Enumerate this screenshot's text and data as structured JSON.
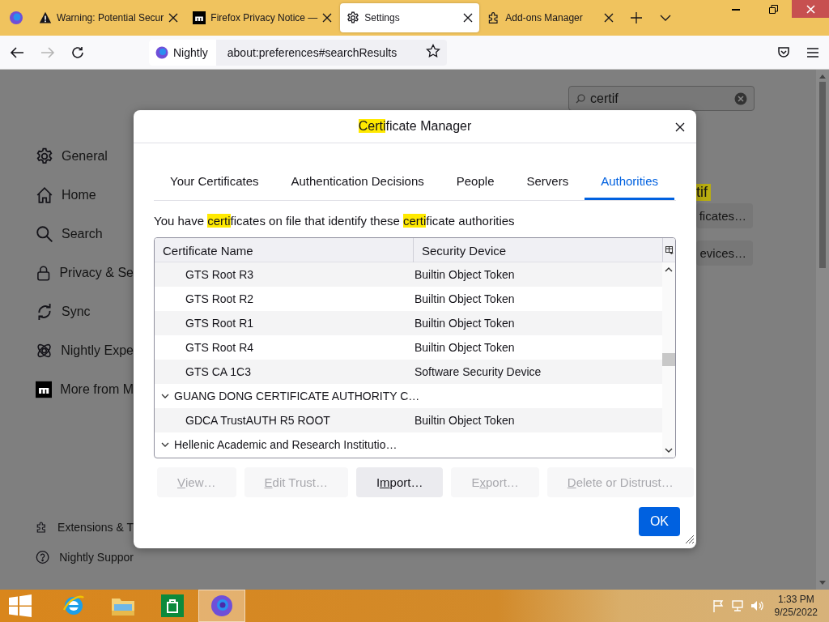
{
  "browser": {
    "tabs": [
      {
        "title": "Warning: Potential Secur",
        "kind": "warning",
        "selected": false
      },
      {
        "title": "Firefox Privacy Notice —",
        "kind": "square",
        "selected": false
      },
      {
        "title": "Settings",
        "kind": "gear",
        "selected": true
      },
      {
        "title": "Add-ons Manager",
        "kind": "puzzle",
        "selected": false
      }
    ],
    "identity": "Nightly",
    "url": "about:preferences#searchResults"
  },
  "sidebar": {
    "items": [
      {
        "label": "General",
        "kind": "gear"
      },
      {
        "label": "Home",
        "kind": "home"
      },
      {
        "label": "Search",
        "kind": "search"
      },
      {
        "label": "Privacy & Se",
        "kind": "lock"
      },
      {
        "label": "Sync",
        "kind": "sync"
      },
      {
        "label": "Nightly Expe",
        "kind": "atom"
      },
      {
        "label": "More from M",
        "kind": "square"
      }
    ],
    "footer": [
      {
        "label": "Extensions & T",
        "kind": "puzzle"
      },
      {
        "label": "Nightly Suppor",
        "kind": "help"
      }
    ]
  },
  "search": {
    "value": "certif"
  },
  "background": {
    "heading": "tif",
    "buttons": [
      "ficates…",
      "evices…"
    ]
  },
  "dialog": {
    "title": [
      {
        "text": "Certi",
        "highlight": true
      },
      {
        "text": "ficate Manager",
        "highlight": false
      }
    ],
    "tabs": [
      {
        "label": "Your Certificates",
        "selected": false
      },
      {
        "label": "Authentication Decisions",
        "selected": false
      },
      {
        "label": "People",
        "selected": false
      },
      {
        "label": "Servers",
        "selected": false
      },
      {
        "label": "Authorities",
        "selected": true
      }
    ],
    "description": [
      {
        "text": "You have ",
        "highlight": false
      },
      {
        "text": "certi",
        "highlight": true
      },
      {
        "text": "ficates on file that identify these ",
        "highlight": false
      },
      {
        "text": "certi",
        "highlight": true
      },
      {
        "text": "ficate authorities",
        "highlight": false
      }
    ],
    "table": {
      "columns": [
        "Certificate Name",
        "Security Device"
      ],
      "rows": [
        {
          "kind": "cert",
          "name": "GTS Root R3",
          "device": "Builtin Object Token"
        },
        {
          "kind": "cert",
          "name": "GTS Root R2",
          "device": "Builtin Object Token"
        },
        {
          "kind": "cert",
          "name": "GTS Root R1",
          "device": "Builtin Object Token"
        },
        {
          "kind": "cert",
          "name": "GTS Root R4",
          "device": "Builtin Object Token"
        },
        {
          "kind": "cert",
          "name": "GTS CA 1C3",
          "device": "Software Security Device"
        },
        {
          "kind": "group",
          "name": "GUANG DONG CERTIFICATE AUTHORITY C…",
          "expanded": true
        },
        {
          "kind": "cert",
          "name": "GDCA TrustAUTH R5 ROOT",
          "device": "Builtin Object Token"
        },
        {
          "kind": "group",
          "name": "Hellenic Academic and Research Institutio…",
          "expanded": true
        }
      ]
    },
    "buttons": [
      {
        "label": [
          {
            "text": "V",
            "underline": true
          },
          {
            "text": "iew…",
            "underline": false
          }
        ],
        "disabled": true
      },
      {
        "label": [
          {
            "text": "E",
            "underline": true
          },
          {
            "text": "dit Trust…",
            "underline": false
          }
        ],
        "disabled": true
      },
      {
        "label": [
          {
            "text": "I",
            "underline": false
          },
          {
            "text": "m",
            "underline": true
          },
          {
            "text": "port…",
            "underline": false
          }
        ],
        "disabled": false
      },
      {
        "label": [
          {
            "text": "E",
            "underline": false
          },
          {
            "text": "x",
            "underline": true
          },
          {
            "text": "port…",
            "underline": false
          }
        ],
        "disabled": true
      },
      {
        "label": [
          {
            "text": "D",
            "underline": true
          },
          {
            "text": "elete or Distrust…",
            "underline": false
          }
        ],
        "disabled": true
      }
    ],
    "ok": "OK"
  },
  "taskbar": {
    "time": "1:33 PM",
    "date": "9/25/2022"
  }
}
